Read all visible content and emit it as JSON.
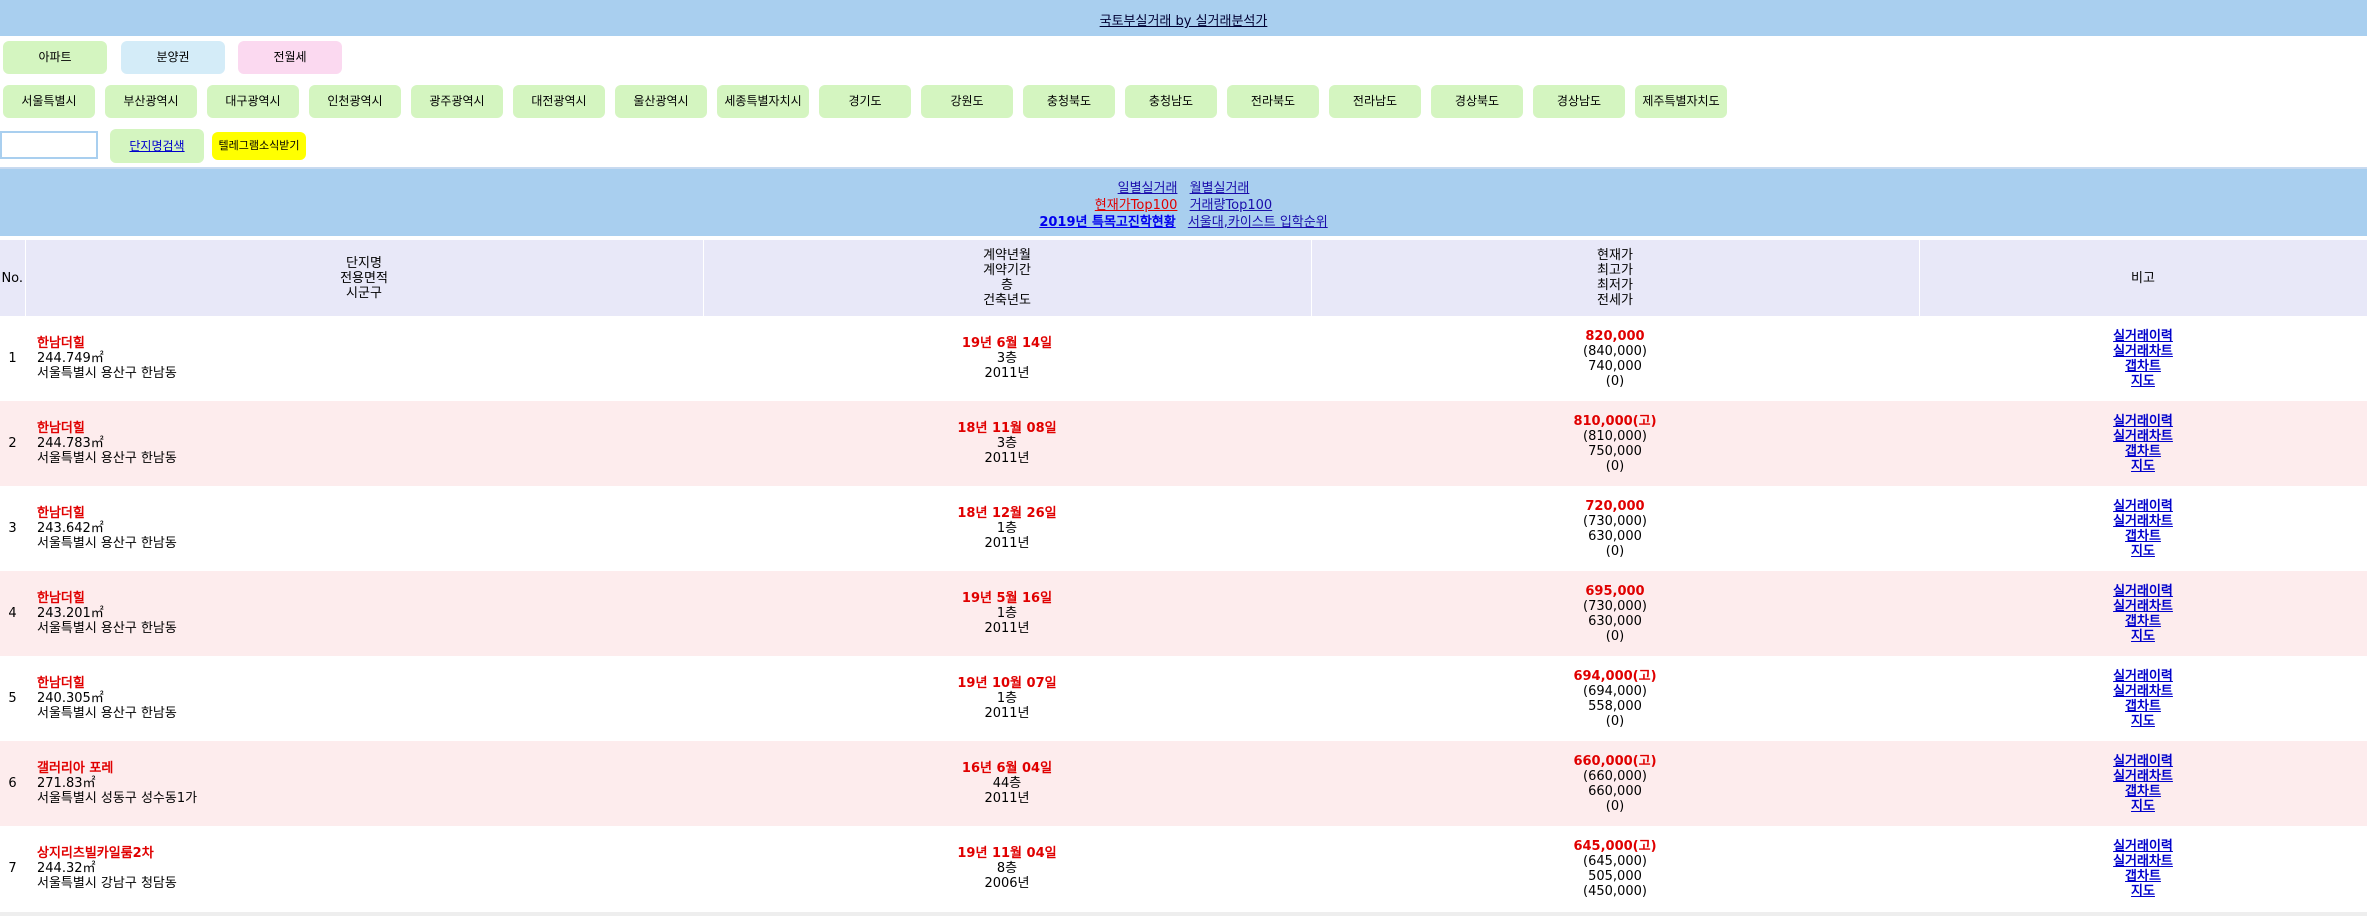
{
  "header": {
    "title": "국토부실거래 by 실거래분석가"
  },
  "categories": [
    {
      "label": "아파트",
      "color": "green"
    },
    {
      "label": "분양권",
      "color": "blue"
    },
    {
      "label": "전월세",
      "color": "pink"
    }
  ],
  "regions": [
    "서울특별시",
    "부산광역시",
    "대구광역시",
    "인천광역시",
    "광주광역시",
    "대전광역시",
    "울산광역시",
    "세종특별자치시",
    "경기도",
    "강원도",
    "충청북도",
    "충청남도",
    "전라북도",
    "전라남도",
    "경상북도",
    "경상남도",
    "제주특별자치도"
  ],
  "search": {
    "button_label": "단지명검색",
    "alarm_label": "텔레그램소식받기",
    "value": ""
  },
  "links": {
    "daily": "일별실거래",
    "monthly": "월별실거래",
    "top100_price": "현재가Top100",
    "top100_volume": "거래량Top100",
    "special_school": "2019년 특목고진학현황",
    "university": "서울대,카이스트 입학순위"
  },
  "table": {
    "headers": {
      "no": "No.",
      "name": [
        "단지명",
        "전용면적",
        "시군구"
      ],
      "contract": [
        "계약년월",
        "계약기간",
        "층",
        "건축년도"
      ],
      "price": [
        "현재가",
        "최고가",
        "최저가",
        "전세가"
      ],
      "note": "비고"
    },
    "note_links": [
      "실거래이력",
      "실거래차트",
      "갭차트",
      "지도"
    ],
    "rows": [
      {
        "no": "1",
        "name": "한남더힐",
        "area": "244.749㎡",
        "region": "서울특별시 용산구 한남동",
        "date": "19년 6월 14일",
        "floor": "3층",
        "built": "2011년",
        "price": "820,000",
        "max": "(840,000)",
        "min": "740,000",
        "jeonse": "(0)"
      },
      {
        "no": "2",
        "name": "한남더힐",
        "area": "244.783㎡",
        "region": "서울특별시 용산구 한남동",
        "date": "18년 11월 08일",
        "floor": "3층",
        "built": "2011년",
        "price": "810,000(고)",
        "max": "(810,000)",
        "min": "750,000",
        "jeonse": "(0)"
      },
      {
        "no": "3",
        "name": "한남더힐",
        "area": "243.642㎡",
        "region": "서울특별시 용산구 한남동",
        "date": "18년 12월 26일",
        "floor": "1층",
        "built": "2011년",
        "price": "720,000",
        "max": "(730,000)",
        "min": "630,000",
        "jeonse": "(0)"
      },
      {
        "no": "4",
        "name": "한남더힐",
        "area": "243.201㎡",
        "region": "서울특별시 용산구 한남동",
        "date": "19년 5월 16일",
        "floor": "1층",
        "built": "2011년",
        "price": "695,000",
        "max": "(730,000)",
        "min": "630,000",
        "jeonse": "(0)"
      },
      {
        "no": "5",
        "name": "한남더힐",
        "area": "240.305㎡",
        "region": "서울특별시 용산구 한남동",
        "date": "19년 10월 07일",
        "floor": "1층",
        "built": "2011년",
        "price": "694,000(고)",
        "max": "(694,000)",
        "min": "558,000",
        "jeonse": "(0)"
      },
      {
        "no": "6",
        "name": "갤러리아 포레",
        "area": "271.83㎡",
        "region": "서울특별시 성동구 성수동1가",
        "date": "16년 6월 04일",
        "floor": "44층",
        "built": "2011년",
        "price": "660,000(고)",
        "max": "(660,000)",
        "min": "660,000",
        "jeonse": "(0)"
      },
      {
        "no": "7",
        "name": "상지리츠빌카일룸2차",
        "area": "244.32㎡",
        "region": "서울특별시 강남구 청담동",
        "date": "19년 11월 04일",
        "floor": "8층",
        "built": "2006년",
        "price": "645,000(고)",
        "max": "(645,000)",
        "min": "505,000",
        "jeonse": "(450,000)"
      }
    ]
  }
}
